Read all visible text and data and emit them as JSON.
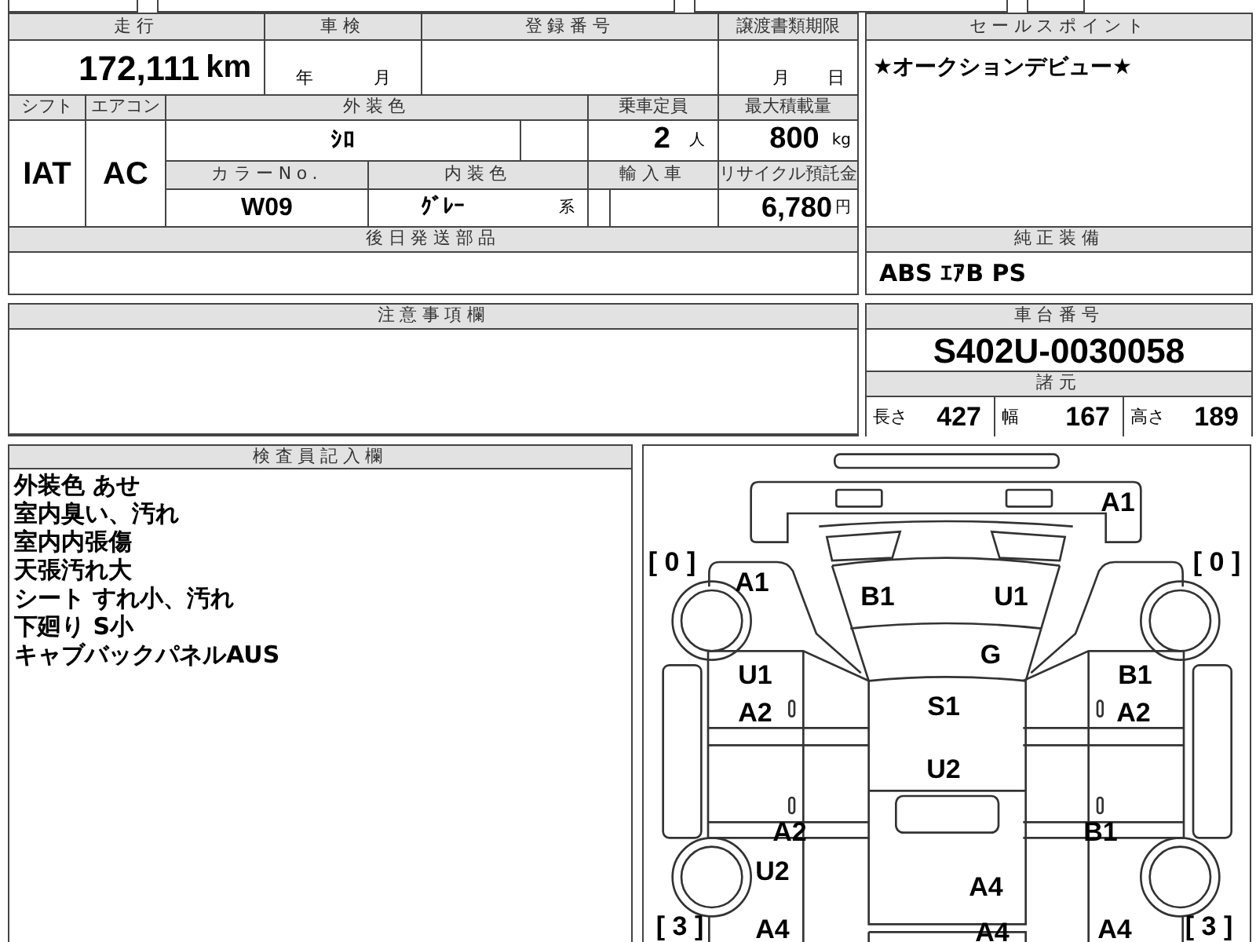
{
  "mileage": {
    "label": "走行",
    "value": "172,111",
    "unit": "km"
  },
  "inspection": {
    "label": "車検",
    "year_unit": "年",
    "month_unit": "月"
  },
  "registration": {
    "label": "登録番号"
  },
  "transfer_deadline": {
    "label": "譲渡書類期限",
    "month_unit": "月",
    "day_unit": "日"
  },
  "shift": {
    "label": "シフト",
    "value": "IAT"
  },
  "aircon": {
    "label": "エアコン",
    "value": "AC"
  },
  "exterior_color": {
    "label": "外装色",
    "value": "ｼﾛ"
  },
  "capacity": {
    "label": "乗車定員",
    "value": "2",
    "unit": "人"
  },
  "max_load": {
    "label": "最大積載量",
    "value": "800",
    "unit": "kg"
  },
  "color_no": {
    "label": "カラーNo.",
    "value": "W09"
  },
  "interior_color": {
    "label": "内装色",
    "value": "ｸﾞﾚｰ",
    "suffix": "系"
  },
  "import": {
    "label": "輸入車"
  },
  "recycle_fee": {
    "label": "リサイクル預託金",
    "value": "6,780",
    "unit": "円"
  },
  "later_parts": {
    "label": "後日発送部品"
  },
  "sales_point": {
    "label": "セールスポイント",
    "text": "★オークションデビュー★"
  },
  "equipment": {
    "label": "純正装備",
    "value": "ABS ｴｱB PS"
  },
  "notes": {
    "label": "注意事項欄"
  },
  "chassis": {
    "label": "車台番号",
    "value": "S402U-0030058"
  },
  "specs": {
    "label": "諸元",
    "items": [
      {
        "label": "長さ",
        "value": "427"
      },
      {
        "label": "幅",
        "value": "167"
      },
      {
        "label": "高さ",
        "value": "189"
      }
    ]
  },
  "inspector": {
    "label": "検査員記入欄",
    "lines": [
      "外装色 あせ",
      "室内臭い、汚れ",
      "室内内張傷",
      "天張汚れ大",
      "シート すれ小、汚れ",
      "下廻り S小",
      "キャブバックパネルAUS"
    ]
  },
  "diagram": {
    "marks": [
      "A1",
      "[ 0 ]",
      "[ 0 ]",
      "A1",
      "B1",
      "U1",
      "G",
      "U1",
      "B1",
      "A2",
      "S1",
      "A2",
      "U2",
      "A2",
      "B1",
      "U2",
      "A4",
      "[ 3 ]",
      "A4",
      "A4",
      "A4",
      "[ 3 ]"
    ]
  }
}
